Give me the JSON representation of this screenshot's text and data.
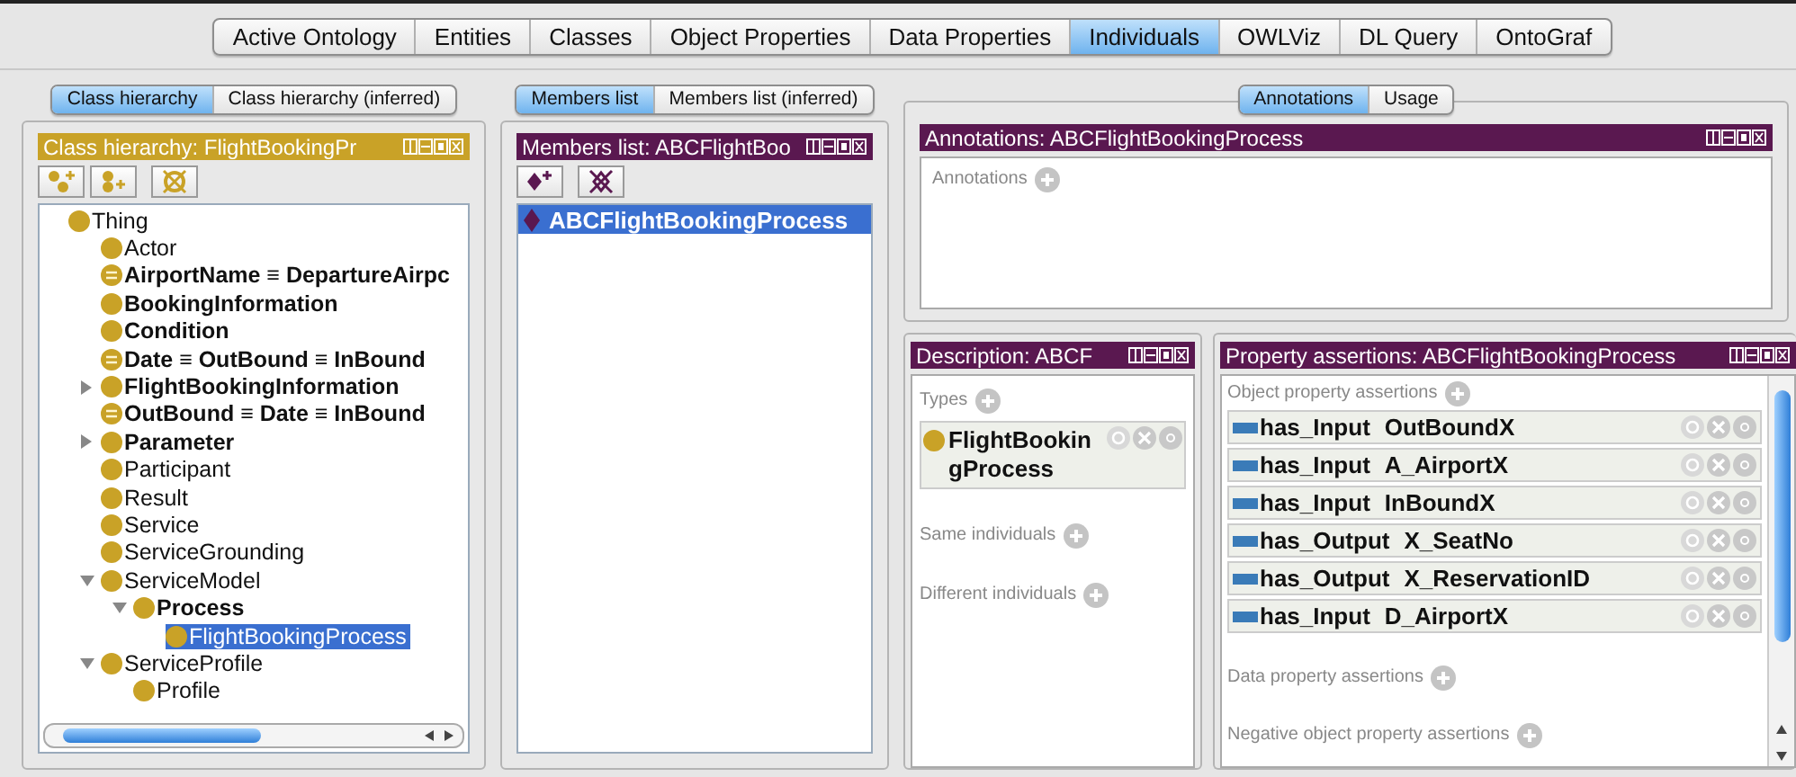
{
  "top_tabs": [
    {
      "label": "Active Ontology",
      "selected": false
    },
    {
      "label": "Entities",
      "selected": false
    },
    {
      "label": "Classes",
      "selected": false
    },
    {
      "label": "Object Properties",
      "selected": false
    },
    {
      "label": "Data Properties",
      "selected": false
    },
    {
      "label": "Individuals",
      "selected": true
    },
    {
      "label": "OWLViz",
      "selected": false
    },
    {
      "label": "DL Query",
      "selected": false
    },
    {
      "label": "OntoGraf",
      "selected": false
    }
  ],
  "class_panel": {
    "view_tabs": [
      {
        "label": "Class hierarchy",
        "selected": true
      },
      {
        "label": "Class hierarchy (inferred)",
        "selected": false
      }
    ],
    "title": "Class hierarchy: FlightBookingPr",
    "tree": [
      {
        "label": "Thing",
        "kind": "class",
        "bold": false,
        "selected": false,
        "children": [
          {
            "label": "Actor",
            "kind": "class",
            "bold": false,
            "selected": false
          },
          {
            "label": "AirportName ≡ DepartureAirpc",
            "kind": "defined",
            "bold": true,
            "selected": false
          },
          {
            "label": "BookingInformation",
            "kind": "class",
            "bold": true,
            "selected": false
          },
          {
            "label": "Condition",
            "kind": "class",
            "bold": true,
            "selected": false
          },
          {
            "label": "Date ≡ OutBound ≡ InBound",
            "kind": "defined",
            "bold": true,
            "selected": false
          },
          {
            "label": "FlightBookingInformation",
            "kind": "class",
            "bold": true,
            "selected": false,
            "expanded": false
          },
          {
            "label": "OutBound ≡ Date ≡ InBound",
            "kind": "defined",
            "bold": true,
            "selected": false
          },
          {
            "label": "Parameter",
            "kind": "class",
            "bold": true,
            "selected": false,
            "expanded": false
          },
          {
            "label": "Participant",
            "kind": "class",
            "bold": false,
            "selected": false
          },
          {
            "label": "Result",
            "kind": "class",
            "bold": false,
            "selected": false
          },
          {
            "label": "Service",
            "kind": "class",
            "bold": false,
            "selected": false
          },
          {
            "label": "ServiceGrounding",
            "kind": "class",
            "bold": false,
            "selected": false
          },
          {
            "label": "ServiceModel",
            "kind": "class",
            "bold": false,
            "selected": false,
            "expanded": true,
            "children": [
              {
                "label": "Process",
                "kind": "class",
                "bold": true,
                "selected": false,
                "expanded": true,
                "children": [
                  {
                    "label": "FlightBookingProcess",
                    "kind": "class",
                    "bold": false,
                    "selected": true
                  }
                ]
              }
            ]
          },
          {
            "label": "ServiceProfile",
            "kind": "class",
            "bold": false,
            "selected": false,
            "expanded": true,
            "children": [
              {
                "label": "Profile",
                "kind": "class",
                "bold": false,
                "selected": false
              }
            ]
          }
        ]
      }
    ]
  },
  "members_panel": {
    "view_tabs": [
      {
        "label": "Members list",
        "selected": true
      },
      {
        "label": "Members list (inferred)",
        "selected": false
      }
    ],
    "title": "Members list: ABCFlightBoo",
    "items": [
      {
        "label": "ABCFlightBookingProcess",
        "selected": true
      }
    ]
  },
  "annotations_panel": {
    "view_tabs": [
      {
        "label": "Annotations",
        "selected": true
      },
      {
        "label": "Usage",
        "selected": false
      }
    ],
    "title": "Annotations: ABCFlightBookingProcess",
    "section": "Annotations"
  },
  "description_panel": {
    "title": "Description: ABCF",
    "sections": [
      {
        "label": "Types",
        "items": [
          "FlightBookingProcess"
        ]
      },
      {
        "label": "Same individuals"
      },
      {
        "label": "Different individuals"
      }
    ]
  },
  "property_panel": {
    "title": "Property assertions: ABCFlightBookingProcess",
    "sections": [
      {
        "label": "Object property assertions",
        "assertions": [
          {
            "property": "has_Input",
            "value": "OutBoundX"
          },
          {
            "property": "has_Input",
            "value": "A_AirportX"
          },
          {
            "property": "has_Input",
            "value": "InBoundX"
          },
          {
            "property": "has_Output",
            "value": "X_SeatNo"
          },
          {
            "property": "has_Output",
            "value": "X_ReservationID"
          },
          {
            "property": "has_Input",
            "value": "D_AirportX"
          }
        ]
      },
      {
        "label": "Data property assertions"
      },
      {
        "label": "Negative object property assertions"
      }
    ]
  }
}
